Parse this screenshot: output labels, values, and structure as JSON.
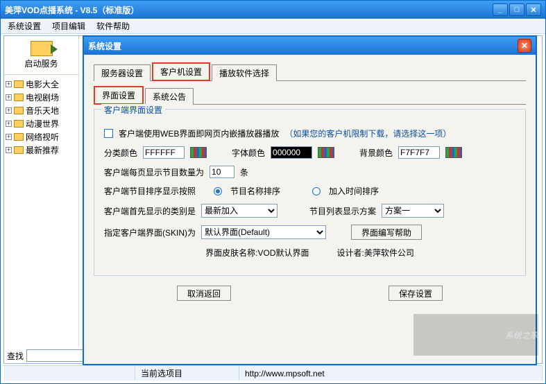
{
  "window": {
    "title": "美萍VOD点播系统 - V8.5（标准版）",
    "menus": [
      "系统设置",
      "项目编辑",
      "软件帮助"
    ]
  },
  "sidebar": {
    "start_service": "启动服务",
    "items": [
      "电影大全",
      "电视剧场",
      "音乐天地",
      "动漫世界",
      "网络视听",
      "最新推荐"
    ]
  },
  "search_label": "查找",
  "statusbar": {
    "current_item_label": "当前选项目",
    "url": "http://www.mpsoft.net"
  },
  "dialog": {
    "title": "系统设置",
    "tabs1": [
      "服务器设置",
      "客户机设置",
      "播放软件选择"
    ],
    "tabs2": [
      "界面设置",
      "系统公告"
    ],
    "group_legend": "客户端界面设置",
    "checkbox_label": "客户端使用WEB界面即网页内嵌播放器播放",
    "checkbox_hint": "（如果您的客户机限制下载，请选择这一项）",
    "color_category_label": "分类颜色",
    "color_category_value": "FFFFFF",
    "color_font_label": "字体颜色",
    "color_font_value": "000000",
    "color_bg_label": "背景颜色",
    "color_bg_value": "F7F7F7",
    "perpage_label_a": "客户端每页显示节目数量为",
    "perpage_value": "10",
    "perpage_label_b": "条",
    "sort_label": "客户端节目排序显示按照",
    "sort_opt1": "节目名称排序",
    "sort_opt2": "加入时间排序",
    "first_cat_label": "客户端首先显示的类别是",
    "first_cat_value": "最新加入",
    "list_scheme_label": "节目列表显示方案",
    "list_scheme_value": "方案一",
    "skin_label": "指定客户端界面(SKIN)为",
    "skin_value": "默认界面(Default)",
    "skin_help_btn": "界面编写帮助",
    "skin_name_label": "界面皮肤名称:VOD默认界面",
    "designer_label": "设计者:美萍软件公司",
    "cancel_btn": "取消返回",
    "save_btn": "保存设置"
  },
  "watermark": "系统之家"
}
